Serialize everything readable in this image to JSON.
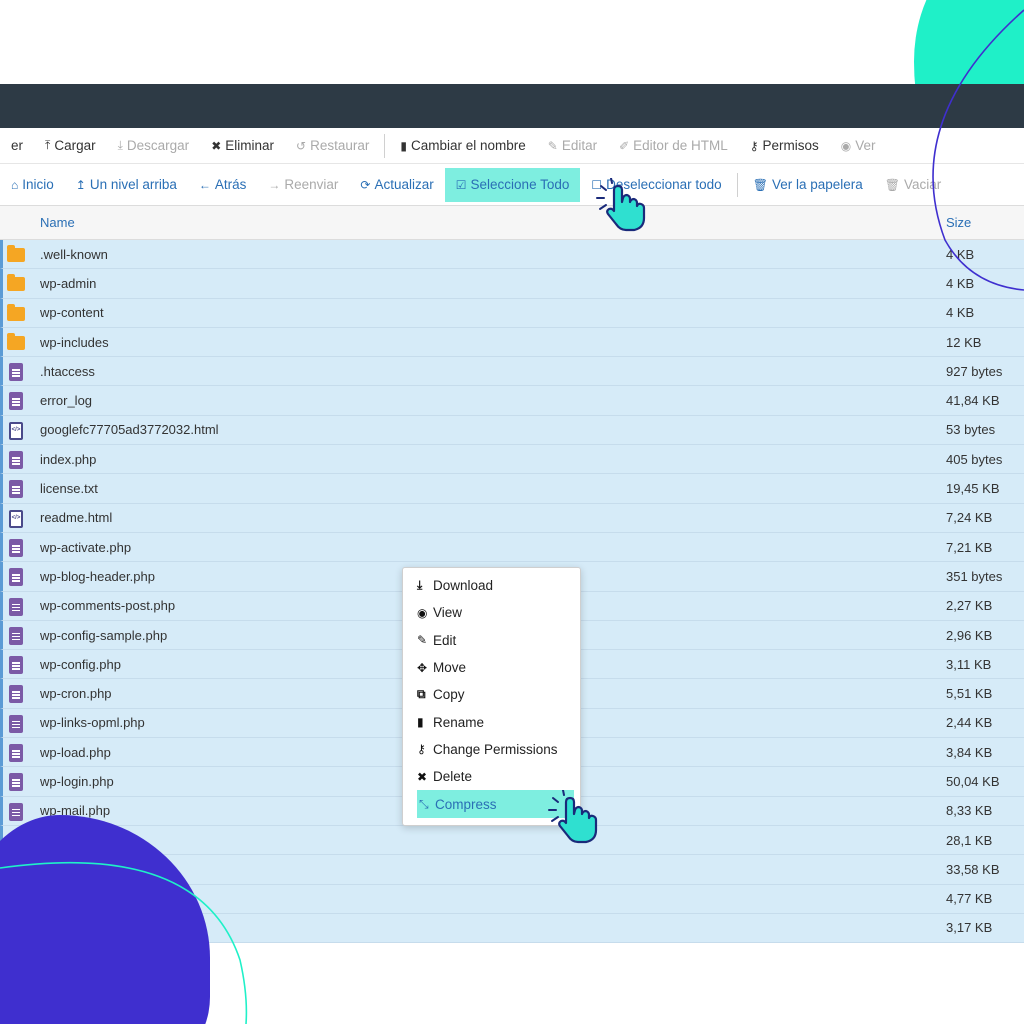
{
  "toolbar_top": {
    "items": [
      {
        "label": "er",
        "icon": "",
        "state": "normal"
      },
      {
        "label": "Cargar",
        "icon": "upload-icon",
        "state": "normal"
      },
      {
        "label": "Descargar",
        "icon": "download-icon",
        "state": "disabled"
      },
      {
        "label": "Eliminar",
        "icon": "close-icon",
        "state": "normal"
      },
      {
        "label": "Restaurar",
        "icon": "undo-icon",
        "state": "disabled"
      },
      {
        "label": "Cambiar el nombre",
        "icon": "file-icon",
        "state": "normal"
      },
      {
        "label": "Editar",
        "icon": "pencil-icon",
        "state": "disabled"
      },
      {
        "label": "Editor de HTML",
        "icon": "edit-icon",
        "state": "disabled"
      },
      {
        "label": "Permisos",
        "icon": "key-icon",
        "state": "normal"
      },
      {
        "label": "Ver",
        "icon": "eye-icon",
        "state": "disabled"
      }
    ]
  },
  "toolbar_nav": {
    "items": [
      {
        "label": "Inicio",
        "icon": "home-icon",
        "state": "link"
      },
      {
        "label": "Un nivel arriba",
        "icon": "level-up-icon",
        "state": "link"
      },
      {
        "label": "Atrás",
        "icon": "arrow-left-icon",
        "state": "link"
      },
      {
        "label": "Reenviar",
        "icon": "arrow-right-icon",
        "state": "disabled"
      },
      {
        "label": "Actualizar",
        "icon": "refresh-icon",
        "state": "link"
      },
      {
        "label": "Seleccione Todo",
        "icon": "checkbox-checked-icon",
        "state": "selected"
      },
      {
        "label": "Deseleccionar todo",
        "icon": "checkbox-icon",
        "state": "link"
      },
      {
        "label": "Ver la papelera",
        "icon": "trash-icon",
        "state": "link"
      },
      {
        "label": "Vaciar",
        "icon": "trash-icon",
        "state": "disabled"
      }
    ]
  },
  "file_list": {
    "columns": {
      "name": "Name",
      "size": "Size"
    },
    "rows": [
      {
        "name": ".well-known",
        "size": "4 KB",
        "type": "folder"
      },
      {
        "name": "wp-admin",
        "size": "4 KB",
        "type": "folder"
      },
      {
        "name": "wp-content",
        "size": "4 KB",
        "type": "folder"
      },
      {
        "name": "wp-includes",
        "size": "12 KB",
        "type": "folder"
      },
      {
        "name": ".htaccess",
        "size": "927 bytes",
        "type": "text"
      },
      {
        "name": "error_log",
        "size": "41,84 KB",
        "type": "text"
      },
      {
        "name": "googlefc77705ad3772032.html",
        "size": "53 bytes",
        "type": "code"
      },
      {
        "name": "index.php",
        "size": "405 bytes",
        "type": "text"
      },
      {
        "name": "license.txt",
        "size": "19,45 KB",
        "type": "text"
      },
      {
        "name": "readme.html",
        "size": "7,24 KB",
        "type": "code"
      },
      {
        "name": "wp-activate.php",
        "size": "7,21 KB",
        "type": "text"
      },
      {
        "name": "wp-blog-header.php",
        "size": "351 bytes",
        "type": "text"
      },
      {
        "name": "wp-comments-post.php",
        "size": "2,27 KB",
        "type": "text"
      },
      {
        "name": "wp-config-sample.php",
        "size": "2,96 KB",
        "type": "text"
      },
      {
        "name": "wp-config.php",
        "size": "3,11 KB",
        "type": "text"
      },
      {
        "name": "wp-cron.php",
        "size": "5,51 KB",
        "type": "text"
      },
      {
        "name": "wp-links-opml.php",
        "size": "2,44 KB",
        "type": "text"
      },
      {
        "name": "wp-load.php",
        "size": "3,84 KB",
        "type": "text"
      },
      {
        "name": "wp-login.php",
        "size": "50,04 KB",
        "type": "text"
      },
      {
        "name": "wp-mail.php",
        "size": "8,33 KB",
        "type": "text"
      },
      {
        "name": "",
        "size": "28,1 KB",
        "type": "none"
      },
      {
        "name": "",
        "size": "33,58 KB",
        "type": "none"
      },
      {
        "name": "",
        "size": "4,77 KB",
        "type": "none"
      },
      {
        "name": "",
        "size": "3,17 KB",
        "type": "none"
      }
    ]
  },
  "context_menu": {
    "items": [
      {
        "label": "Download",
        "icon": "download-icon",
        "glyph": "⤓"
      },
      {
        "label": "View",
        "icon": "eye-icon",
        "glyph": "◉"
      },
      {
        "label": "Edit",
        "icon": "pencil-icon",
        "glyph": "✎"
      },
      {
        "label": "Move",
        "icon": "move-icon",
        "glyph": "✥"
      },
      {
        "label": "Copy",
        "icon": "copy-icon",
        "glyph": "⧉"
      },
      {
        "label": "Rename",
        "icon": "file-icon",
        "glyph": "▮"
      },
      {
        "label": "Change Permissions",
        "icon": "key-icon",
        "glyph": "⚷"
      },
      {
        "label": "Delete",
        "icon": "close-icon",
        "glyph": "✖"
      },
      {
        "label": "Compress",
        "icon": "compress-icon",
        "glyph": "⤡"
      }
    ],
    "highlighted": "Compress"
  },
  "colors": {
    "topbar": "#2d3a45",
    "highlight": "#7eeee0",
    "link": "#2a6fb5",
    "row_selected": "#d6ebf8",
    "deco_green": "#1ff0c8",
    "deco_purple": "#3f2fcf"
  }
}
